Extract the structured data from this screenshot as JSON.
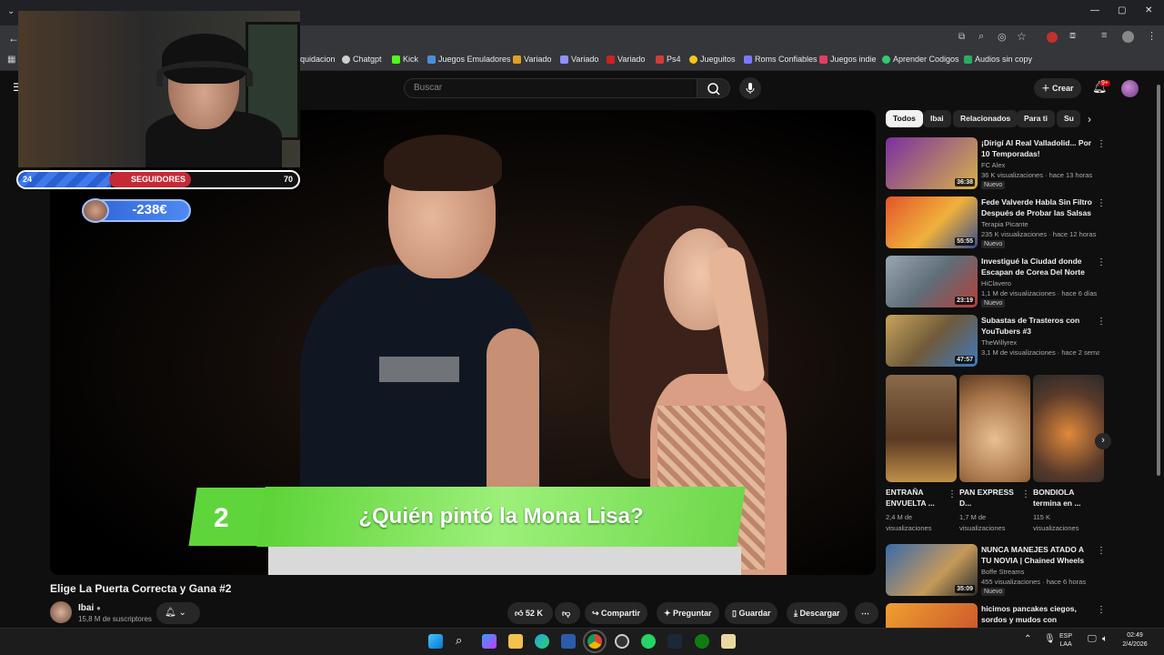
{
  "browser": {
    "window_controls": [
      "—",
      "▢",
      "✕"
    ],
    "bookmarks": [
      {
        "label": "iquidacion",
        "color": "#7a7a7a"
      },
      {
        "label": "Chatgpt",
        "color": "#d0d0d0"
      },
      {
        "label": "Kick",
        "color": "#53fc18"
      },
      {
        "label": "Juegos Emuladores",
        "color": "#4a90d9"
      },
      {
        "label": "Variado",
        "color": "#e0a020"
      },
      {
        "label": "Variado",
        "color": "#9090ff"
      },
      {
        "label": "Variado",
        "color": "#cc2222"
      },
      {
        "label": "Ps4",
        "color": "#d33b3b"
      },
      {
        "label": "Jueguitos",
        "color": "#f5c518"
      },
      {
        "label": "Roms Confiables",
        "color": "#7a7aff"
      },
      {
        "label": "Juegos indie",
        "color": "#e04060"
      },
      {
        "label": "Aprender Codigos",
        "color": "#2ecc71"
      },
      {
        "label": "Audios sin copy",
        "color": "#27ae60"
      }
    ]
  },
  "youtube": {
    "search_placeholder": "Buscar",
    "create_label": "Crear",
    "notif_count": "9+"
  },
  "overlay": {
    "followers_label": "SEGUIDORES",
    "followers_min": "24",
    "followers_max": "70",
    "followers_progress": 0.33,
    "money": "-238€"
  },
  "video": {
    "question_number": "2",
    "question_text": "¿Quién pintó la Mona Lisa?",
    "title": "Elige La Puerta Correcta y Gana #2",
    "channel": "Ibai",
    "subscribers": "15,8 M de suscriptores",
    "likes": "52 K",
    "actions": {
      "share": "Compartir",
      "ask": "Preguntar",
      "save": "Guardar",
      "download": "Descargar"
    }
  },
  "chips": [
    "Todos",
    "Ibai",
    "Relacionados",
    "Para ti",
    "Su"
  ],
  "recommended": [
    {
      "title": "¡Dirigí Al Real Valladolid... Por 10 Temporadas!",
      "channel": "FC Alex",
      "meta": "36 K visualizaciones · hace 13 horas",
      "badge": "Nuevo",
      "duration": "36:38",
      "thumb": "#6a2a8a"
    },
    {
      "title": "Fede Valverde Habla Sin Filtro Después de Probar las Salsas ...",
      "channel": "Terapia Picante",
      "meta": "235 K visualizaciones · hace 12 horas",
      "badge": "Nuevo",
      "duration": "55:55",
      "thumb": "#c83c1e"
    },
    {
      "title": "Investigué la Ciudad donde Escapan de Corea Del Norte",
      "channel": "HiClavero",
      "meta": "1,1 M de visualizaciones · hace 6 días",
      "badge": "Nuevo",
      "duration": "23:19",
      "thumb": "#6f7c88"
    },
    {
      "title": "Subastas de Trasteros con YouTubers #3",
      "channel": "TheWillyrex",
      "meta": "3,1 M de visualizaciones · hace 2 seman...",
      "badge": "",
      "duration": "47:57",
      "thumb": "#8a6a3a"
    }
  ],
  "shorts": [
    {
      "title": "ENTRAÑA ENVUELTA ...",
      "meta": "2,4 M de visualizaciones",
      "thumb": "#6b4a2c"
    },
    {
      "title": "PAN EXPRESS D...",
      "meta": "1,7 M de visualizaciones",
      "thumb": "#b98a5c"
    },
    {
      "title": "BONDIOLA termina en ...",
      "meta": "115 K visualizaciones",
      "thumb": "#4a3a30"
    }
  ],
  "recommended2": [
    {
      "title": "NUNCA MANEJES ATADO A TU NOVIA | Chained Wheels",
      "channel": "Boffe Streams",
      "meta": "455 visualizaciones · hace 6 horas",
      "badge": "Nuevo",
      "duration": "35:09",
      "thumb": "#2a5a8a"
    },
    {
      "title": "hicimos pancakes ciegos, sordos y mudos con CARRERA...",
      "channel": "",
      "meta": "",
      "badge": "",
      "duration": "",
      "thumb": "#e0a030"
    }
  ],
  "tray": {
    "lang": "ESP",
    "layout": "LAA",
    "time": "02:49",
    "date": "2/4/2026"
  }
}
